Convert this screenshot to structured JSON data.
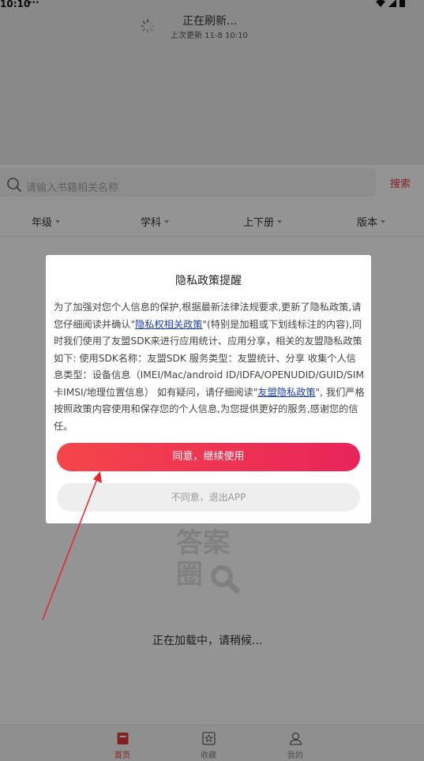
{
  "status_bar": {
    "time": "10:10",
    "dots": "···"
  },
  "refresh": {
    "title": "正在刷新...",
    "last_update": "上次更新 11-8 10:10"
  },
  "search": {
    "placeholder": "请输入书籍相关名称",
    "button_label": "搜索"
  },
  "filters": [
    {
      "label": "年级"
    },
    {
      "label": "学科"
    },
    {
      "label": "上下册"
    },
    {
      "label": "版本"
    }
  ],
  "logo": {
    "line1": "答案",
    "line2": "圈"
  },
  "loading_text": "正在加载中，请稍候...",
  "tabs": [
    {
      "label": "首页",
      "active": true
    },
    {
      "label": "收藏",
      "active": false
    },
    {
      "label": "我的",
      "active": false
    }
  ],
  "modal": {
    "title": "隐私政策提醒",
    "body_part1": "为了加强对您个人信息的保护,根据最新法律法规要求,更新了隐私政策,请您仔细阅读并确认\"",
    "link1": "隐私权相关政策",
    "body_part2": "\"(特别是加粗或下划线标注的内容),同时我们使用了友盟SDK来进行应用统计、应用分享，相关的友盟隐私政策如下: 使用SDK名称：友盟SDK 服务类型：友盟统计、分享 收集个人信息类型：设备信息（IMEI/Mac/android ID/IDFA/OPENUDID/GUID/SIM卡IMSI/地理位置信息） 如有疑问，请仔细阅读\"",
    "link2": "友盟隐私政策",
    "body_part3": "\", 我们严格按照政策内容使用和保存您的个人信息,为您提供更好的服务,感谢您的信任。",
    "agree_label": "同意，继续使用",
    "disagree_label": "不同意，退出APP"
  },
  "colors": {
    "accent": "#e03a3a",
    "link": "#1a3fb5",
    "gradient_start": "#f4464a",
    "gradient_end": "#e8245a"
  }
}
